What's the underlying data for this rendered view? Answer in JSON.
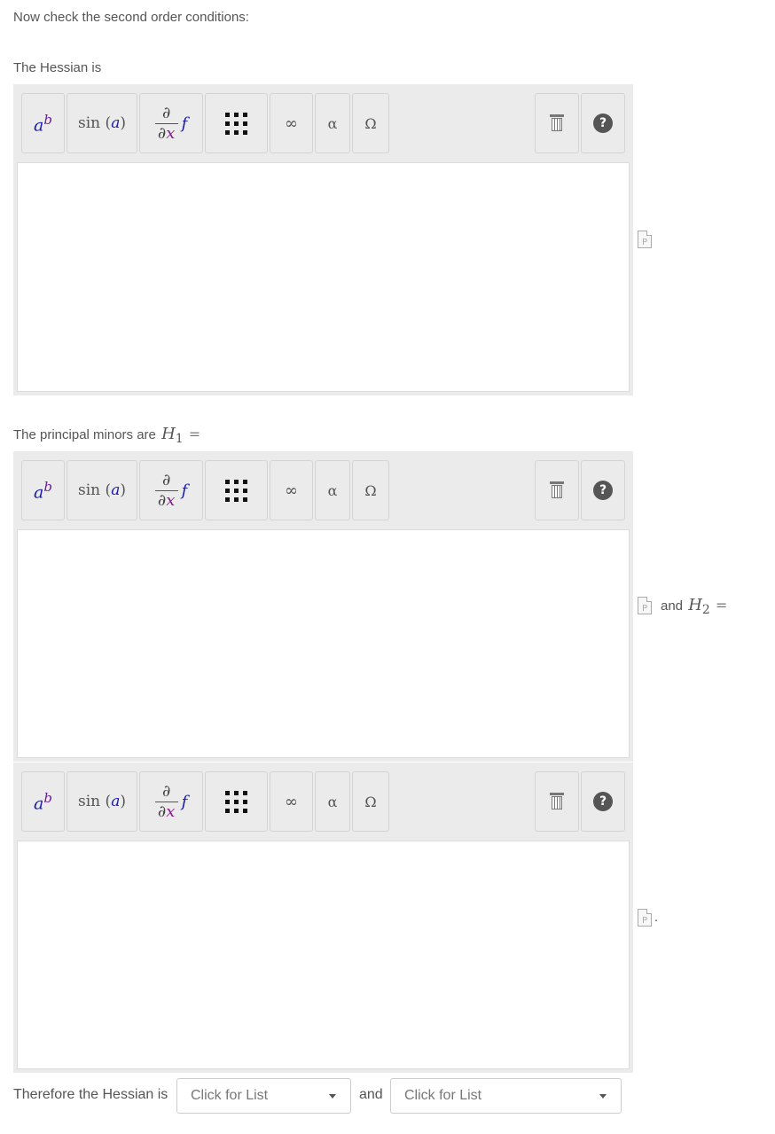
{
  "intro_text": "Now check the second order conditions:",
  "hessian_label": "The Hessian is",
  "minors_label": "The principal minors are",
  "h1_symbol": "H",
  "h1_sub": "1",
  "and_text": "and",
  "h2_symbol": "H",
  "h2_sub": "2",
  "equals": "=",
  "period": ".",
  "therefore_label": "Therefore the Hessian is",
  "conj": "and",
  "editor_toolbar": {
    "power_base": "a",
    "power_exp": "b",
    "sin_func": "sin",
    "sin_arg": "a",
    "deriv_num": "∂",
    "deriv_den_partial": "∂",
    "deriv_den_var": "x",
    "deriv_f": "f",
    "infinity": "∞",
    "alpha": "α",
    "omega": "Ω",
    "help": "?"
  },
  "preview_icon_letter": "P",
  "dropdown1": {
    "placeholder": "Click for List"
  },
  "dropdown2": {
    "placeholder": "Click for List"
  },
  "icons": [
    "matrix-icon",
    "trash-icon",
    "help-icon",
    "preview-doc-icon",
    "dropdown-caret-icon"
  ]
}
